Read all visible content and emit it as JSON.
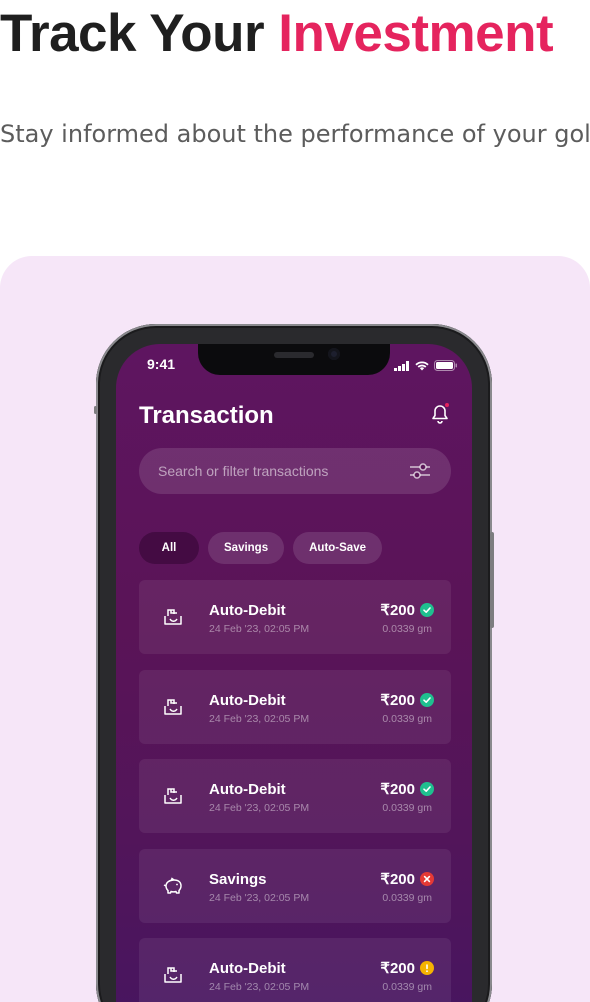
{
  "headline": {
    "lead": "Track Your ",
    "accent": "Investment"
  },
  "subtitle": "Stay informed about the performance of your gold investments with real-time tracking. Mo...",
  "colors": {
    "accent": "#e5245e",
    "showcase_bg": "#f6e6f8",
    "app_bg": "#5e1560",
    "success": "#1fbf8f",
    "error": "#e53935",
    "pending": "#f5b301"
  },
  "phone": {
    "status_time": "9:41",
    "app_title": "Transaction",
    "search_placeholder": "Search or filter transactions",
    "filters": [
      "All",
      "Savings",
      "Auto-Save"
    ],
    "active_filter": "All",
    "transactions": [
      {
        "title": "Auto-Debit",
        "date": "24 Feb '23, 02:05 PM",
        "amount": "₹200",
        "weight": "0.0339 gm",
        "icon": "auto-debit-icon",
        "status": "success"
      },
      {
        "title": "Auto-Debit",
        "date": "24 Feb '23, 02:05 PM",
        "amount": "₹200",
        "weight": "0.0339 gm",
        "icon": "auto-debit-icon",
        "status": "success"
      },
      {
        "title": "Auto-Debit",
        "date": "24 Feb '23, 02:05 PM",
        "amount": "₹200",
        "weight": "0.0339 gm",
        "icon": "auto-debit-icon",
        "status": "success"
      },
      {
        "title": "Savings",
        "date": "24 Feb '23, 02:05 PM",
        "amount": "₹200",
        "weight": "0.0339 gm",
        "icon": "piggy-bank-icon",
        "status": "failed"
      },
      {
        "title": "Auto-Debit",
        "date": "24 Feb '23, 02:05 PM",
        "amount": "₹200",
        "weight": "0.0339 gm",
        "icon": "auto-debit-icon",
        "status": "pending"
      }
    ]
  }
}
